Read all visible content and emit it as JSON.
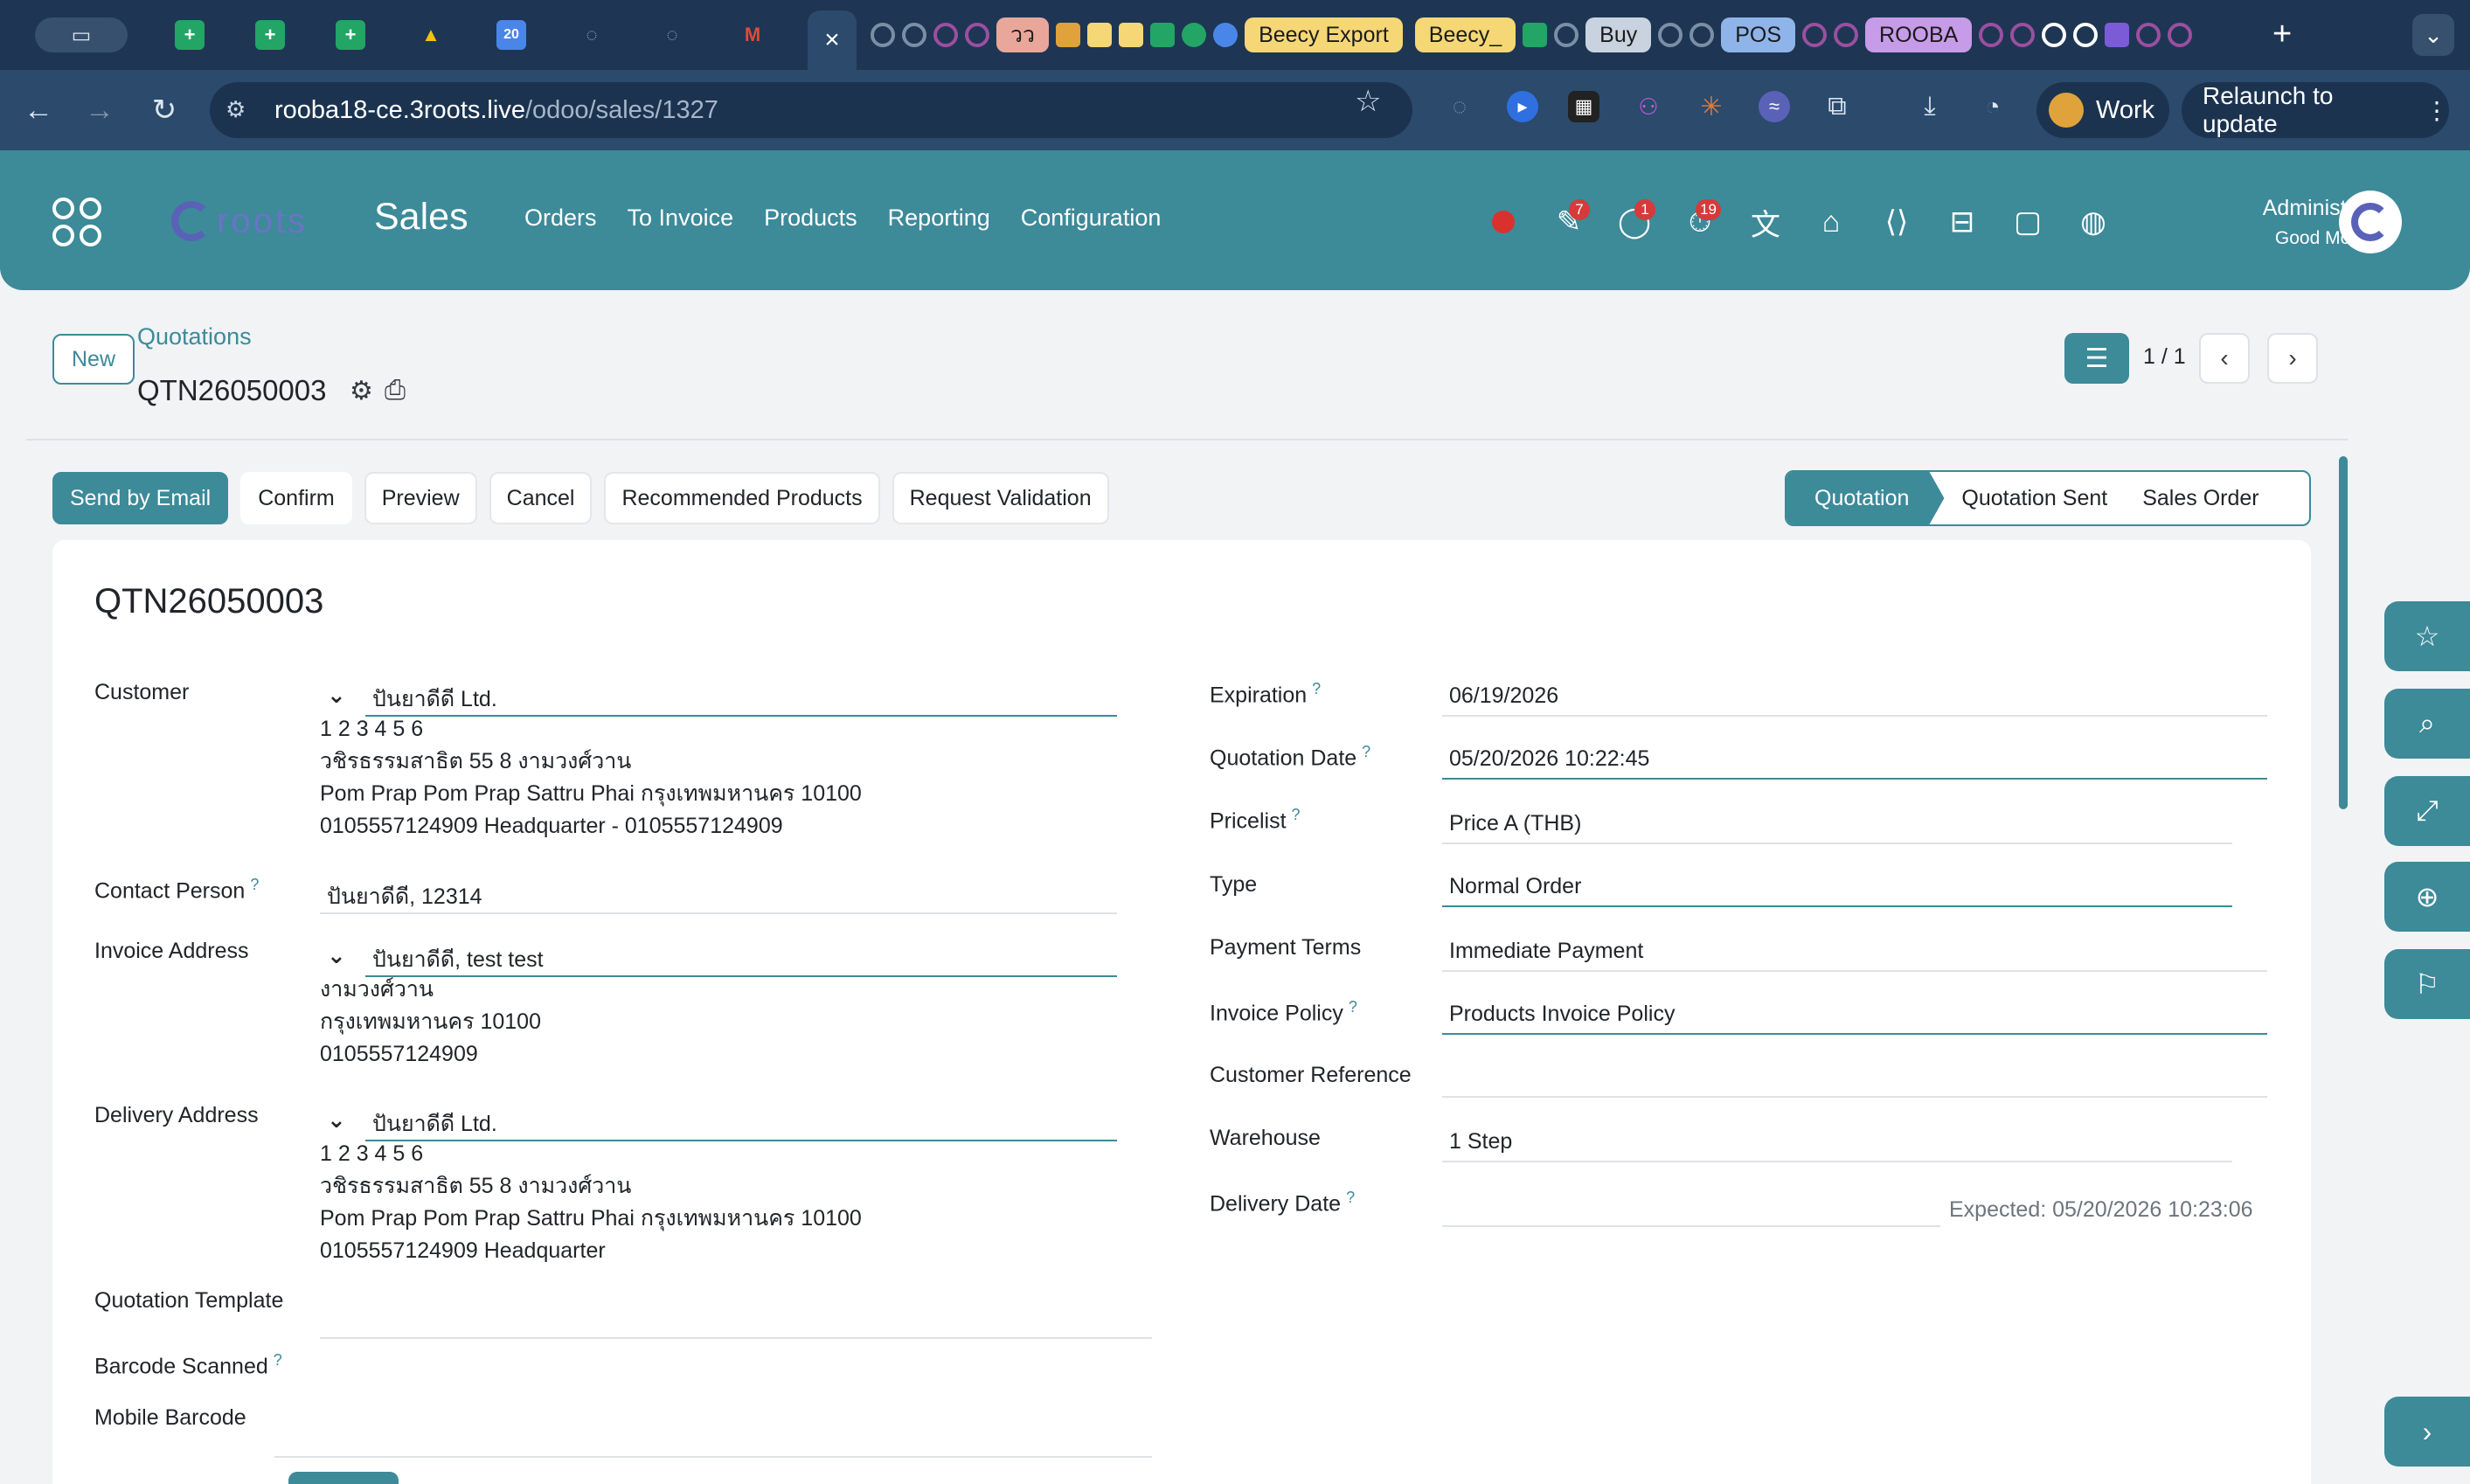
{
  "browser": {
    "tab_chips": [
      "Beecy Export",
      "Beecy_",
      "Buy",
      "POS",
      "ROOBA"
    ],
    "small_chip": "วว",
    "url_host": "rooba18-ce.3roots.live",
    "url_path": "/odoo/sales/1327",
    "profile_label": "Work",
    "relaunch_label": "Relaunch to update"
  },
  "nav": {
    "brand": "roots",
    "app_title": "Sales",
    "menu": [
      "Orders",
      "To Invoice",
      "Products",
      "Reporting",
      "Configuration"
    ],
    "badges": {
      "activities": "7",
      "messages": "1",
      "timer": "19"
    },
    "user": "Administrator",
    "greeting": "Good Morning"
  },
  "control": {
    "new_label": "New",
    "breadcrumb": "Quotations",
    "record": "QTN26050003",
    "pager": "1 / 1"
  },
  "actions": [
    "Send by Email",
    "Confirm",
    "Preview",
    "Cancel",
    "Recommended Products",
    "Request Validation"
  ],
  "stages": [
    "Quotation",
    "Quotation Sent",
    "Sales Order"
  ],
  "form": {
    "title": "QTN26050003",
    "customer_label": "Customer",
    "customer": "ปันยาดีดี Ltd.",
    "customer_addr": [
      "1 2 3 4 5 6",
      "วชิรธรรมสาธิต 55 8 งามวงศ์วาน",
      "Pom Prap Pom Prap Sattru Phai กรุงเทพมหานคร 10100",
      "0105557124909 Headquarter - 0105557124909"
    ],
    "contact_label": "Contact Person",
    "contact": "ปันยาดีดี, 12314",
    "invoice_label": "Invoice Address",
    "invoice": "ปันยาดีดี, test test",
    "invoice_addr": [
      "งามวงศ์วาน",
      "กรุงเทพมหานคร 10100",
      "0105557124909"
    ],
    "delivery_label": "Delivery Address",
    "delivery": "ปันยาดีดี Ltd.",
    "delivery_addr": [
      "1 2 3 4 5 6",
      "วชิรธรรมสาธิต 55 8 งามวงศ์วาน",
      "Pom Prap Pom Prap Sattru Phai กรุงเทพมหานคร 10100",
      "0105557124909 Headquarter"
    ],
    "template_label": "Quotation Template",
    "barcode_label": "Barcode Scanned",
    "mobile_barcode_label": "Mobile Barcode",
    "expiration_label": "Expiration",
    "expiration": "06/19/2026",
    "qdate_label": "Quotation Date",
    "qdate": "05/20/2026 10:22:45",
    "pricelist_label": "Pricelist",
    "pricelist": "Price A (THB)",
    "type_label": "Type",
    "type": "Normal Order",
    "terms_label": "Payment Terms",
    "terms": "Immediate Payment",
    "policy_label": "Invoice Policy",
    "policy": "Products Invoice Policy",
    "custref_label": "Customer Reference",
    "warehouse_label": "Warehouse",
    "warehouse": "1 Step",
    "ddate_label": "Delivery Date",
    "expected": "Expected: 05/20/2026 10:23:06"
  }
}
